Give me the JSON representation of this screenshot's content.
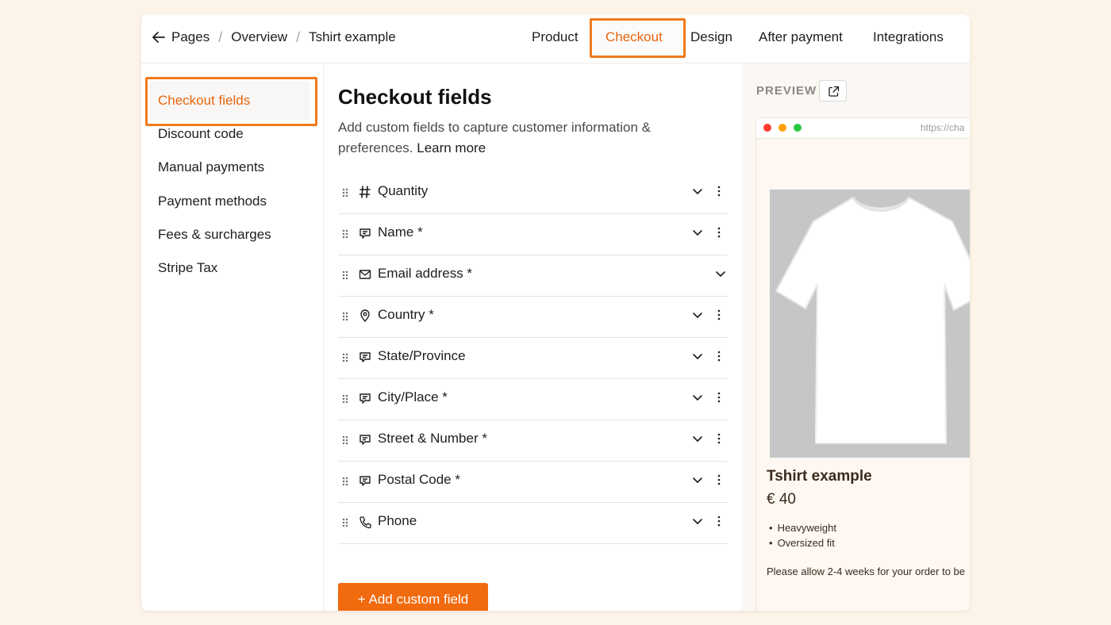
{
  "breadcrumb": {
    "items": [
      "Pages",
      "Overview",
      "Tshirt example"
    ],
    "separator": "/"
  },
  "tabs": [
    {
      "label": "Product",
      "active": false
    },
    {
      "label": "Checkout",
      "active": true
    },
    {
      "label": "Design",
      "active": false
    },
    {
      "label": "After payment",
      "active": false
    },
    {
      "label": "Integrations",
      "active": false
    }
  ],
  "sidebar": {
    "items": [
      {
        "label": "Checkout fields",
        "active": true
      },
      {
        "label": "Discount code",
        "active": false
      },
      {
        "label": "Manual payments",
        "active": false
      },
      {
        "label": "Payment methods",
        "active": false
      },
      {
        "label": "Fees & surcharges",
        "active": false
      },
      {
        "label": "Stripe Tax",
        "active": false
      }
    ]
  },
  "main": {
    "title": "Checkout fields",
    "description": "Add custom fields to capture customer information & preferences.",
    "learn_more": "Learn more",
    "fields": [
      {
        "label": "Quantity",
        "icon": "hash-icon"
      },
      {
        "label": "Name *",
        "icon": "message-icon"
      },
      {
        "label": "Email address *",
        "icon": "mail-icon"
      },
      {
        "label": "Country *",
        "icon": "location-pin-icon"
      },
      {
        "label": "State/Province",
        "icon": "message-icon"
      },
      {
        "label": "City/Place *",
        "icon": "message-icon"
      },
      {
        "label": "Street & Number *",
        "icon": "message-icon"
      },
      {
        "label": "Postal Code *",
        "icon": "message-icon"
      },
      {
        "label": "Phone",
        "icon": "phone-icon"
      }
    ],
    "add_button": "+ Add custom field"
  },
  "preview": {
    "label": "PREVIEW",
    "url": "https://cha",
    "product_title": "Tshirt example",
    "price": "€ 40",
    "features": [
      "Heavyweight",
      "Oversized fit"
    ],
    "note": "Please allow 2-4 weeks for your order to be"
  },
  "colors": {
    "accent": "#e8650e",
    "highlight_border": "#f07a1c",
    "button": "#f26a0e",
    "background": "#fcf3e9"
  }
}
